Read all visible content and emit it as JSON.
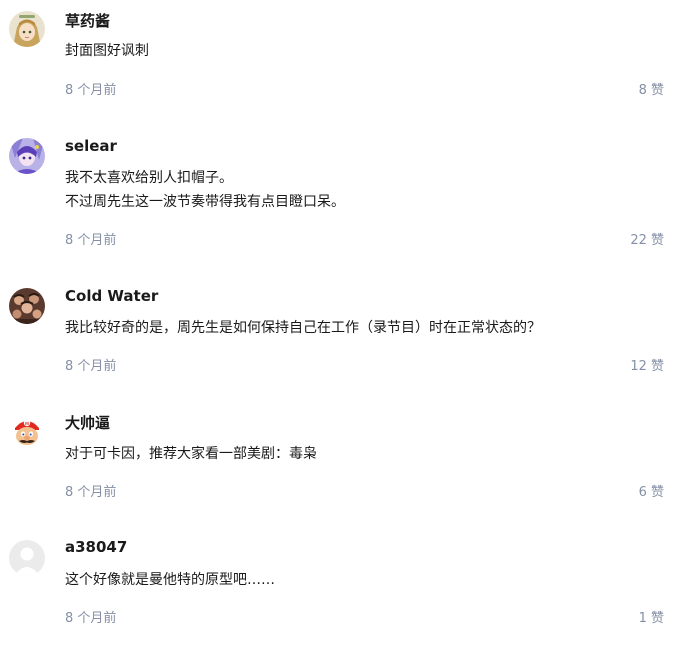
{
  "comments": [
    {
      "author": "草药酱",
      "avatar_icon": "anime-girl-avatar-icon",
      "lines": [
        "封面图好讽刺"
      ],
      "time": "8 个月前",
      "likes": "8 赞"
    },
    {
      "author": "selear",
      "avatar_icon": "purple-character-avatar-icon",
      "lines": [
        "我不太喜欢给别人扣帽子。",
        "不过周先生这一波节奏带得我有点目瞪口呆。"
      ],
      "time": "8 个月前",
      "likes": "22 赞"
    },
    {
      "author": "Cold Water",
      "avatar_icon": "group-photo-avatar-icon",
      "lines": [
        "我比较好奇的是，周先生是如何保持自己在工作（录节目）时在正常状态的？"
      ],
      "time": "8 个月前",
      "likes": "12 赞"
    },
    {
      "author": "大帅逼",
      "avatar_icon": "mario-avatar-icon",
      "lines": [
        "对于可卡因，推荐大家看一部美剧：毒枭"
      ],
      "time": "8 个月前",
      "likes": "6 赞"
    },
    {
      "author": "a38047",
      "avatar_icon": "default-user-avatar-icon",
      "lines": [
        "这个好像就是曼他特的原型吧……"
      ],
      "time": "8 个月前",
      "likes": "1 赞"
    }
  ]
}
